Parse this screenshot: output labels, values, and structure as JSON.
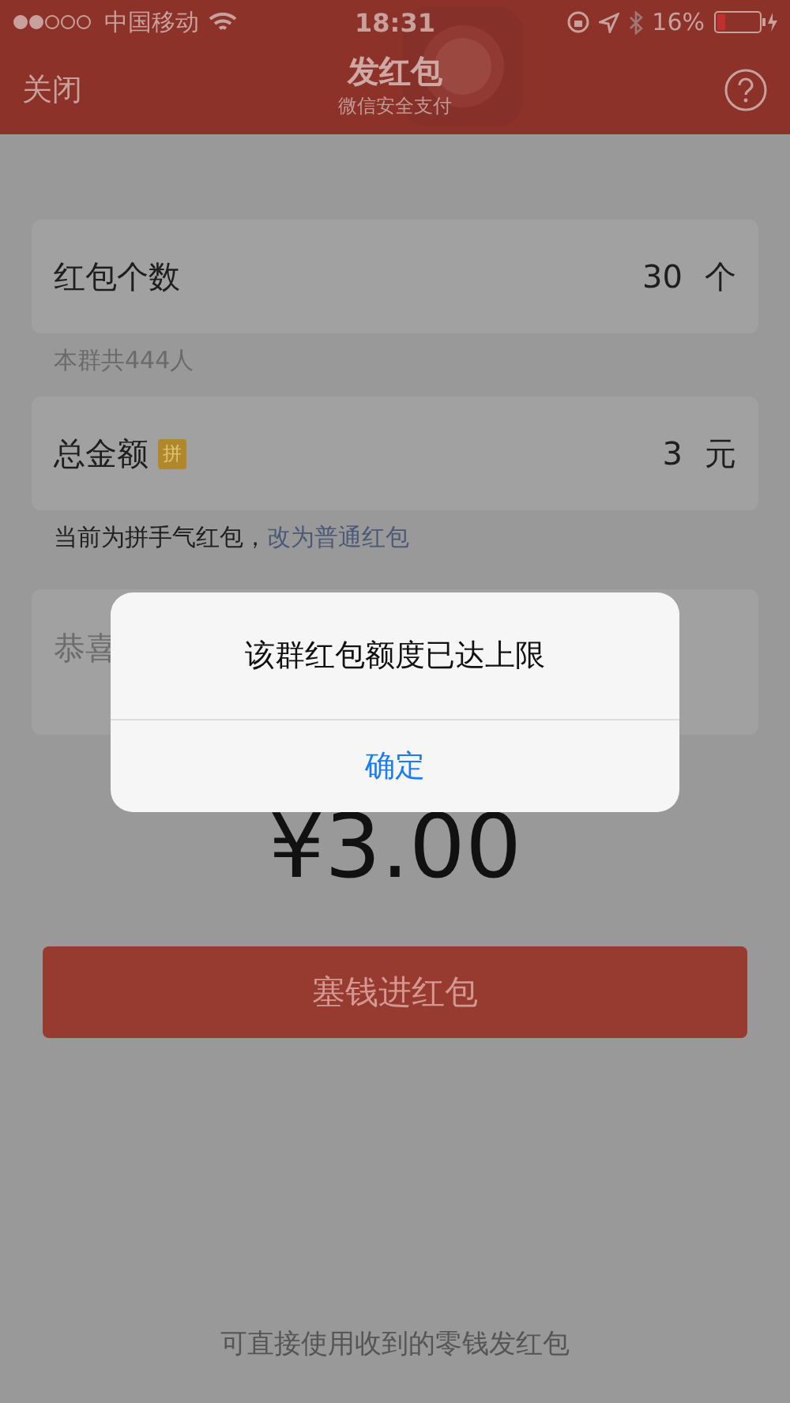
{
  "status_bar": {
    "carrier": "中国移动",
    "time": "18:31",
    "battery": "16%"
  },
  "nav": {
    "close": "关闭",
    "title": "发红包",
    "subtitle": "微信安全支付"
  },
  "fields": [
    {
      "label": "红包个数",
      "value": "30",
      "unit": "个",
      "note": "本群共444人"
    },
    {
      "label": "总金额",
      "badge": "拼",
      "value": "3",
      "unit": "元",
      "note": "当前为拼手气红包，",
      "note_link": "改为普通红包"
    }
  ],
  "greeting": {
    "placeholder": "恭喜"
  },
  "amount": "¥3.00",
  "submit": "塞钱进红包",
  "footer": "可直接使用收到的零钱发红包",
  "alert": {
    "message": "该群红包额度已达上限",
    "button": "确定"
  }
}
